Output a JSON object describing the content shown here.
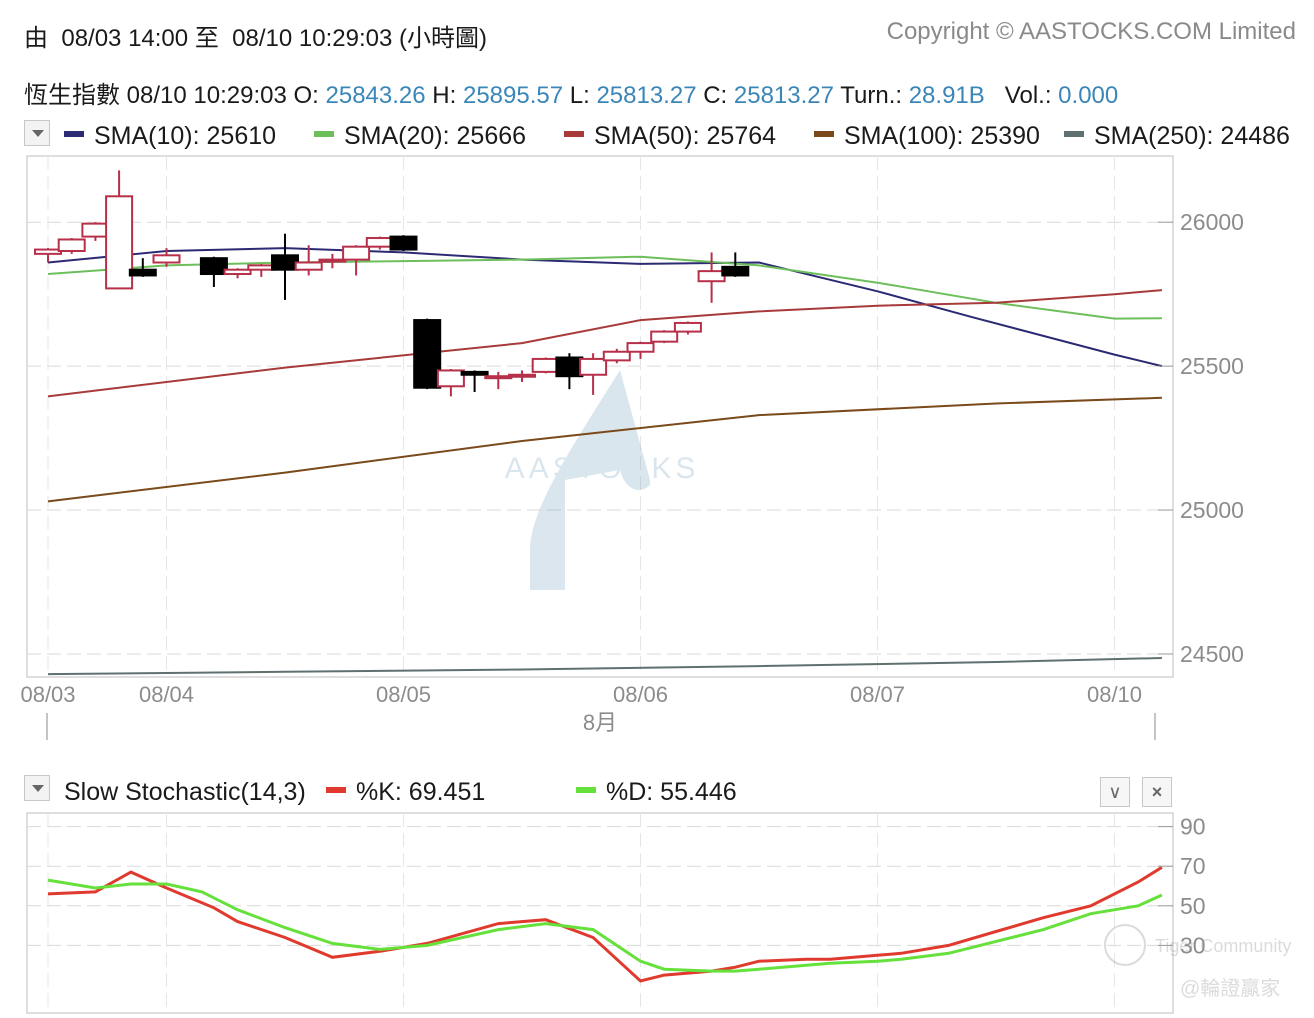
{
  "header": {
    "range_prefix": "由",
    "range_from": "08/03 14:00",
    "range_to_word": "至",
    "range_to": "08/10 10:29:03",
    "range_mode": "(小時圖)",
    "copyright": "Copyright © AASTOCKS.COM Limited"
  },
  "quote": {
    "name": "恆生指數",
    "time": "08/10 10:29:03",
    "open_label": "O:",
    "open": "25843.26",
    "high_label": "H:",
    "high": "25895.57",
    "low_label": "L:",
    "low": "25813.27",
    "close_label": "C:",
    "close": "25813.27",
    "turn_label": "Turn.:",
    "turn": "28.91B",
    "vol_label": "Vol.:",
    "vol": "0.000"
  },
  "sma_legend": [
    {
      "label": "SMA(10): 25610",
      "color": "#2b2a73"
    },
    {
      "label": "SMA(20): 25666",
      "color": "#6cbf5a"
    },
    {
      "label": "SMA(50): 25764",
      "color": "#a83a3a"
    },
    {
      "label": "SMA(100): 25390",
      "color": "#7a4a1a"
    },
    {
      "label": "SMA(250): 24486",
      "color": "#5f7070"
    }
  ],
  "stoch_legend": {
    "title": "Slow Stochastic(14,3)",
    "k_label": "%K: 69.451",
    "d_label": "%D: 55.446",
    "k_color": "#e03a2e",
    "d_color": "#66e03a"
  },
  "watermark": {
    "text": "AASTOCKS",
    "tiger": "Tiger Community",
    "author": "@輪證贏家"
  },
  "chart_data": [
    {
      "type": "candlestick",
      "y_ticks": [
        "26000",
        "25500",
        "25000",
        "24500"
      ],
      "ylim": [
        24420,
        26230
      ],
      "x_tick_labels": [
        "08/03",
        "08/04",
        "08/05",
        "08/06",
        "08/07",
        "08/10"
      ],
      "x_tick_index": [
        0,
        5,
        15,
        25,
        35,
        45
      ],
      "month_label": "8月",
      "up_color": "#b7304a",
      "down_color": "#000000",
      "candles": [
        {
          "o": 25890,
          "h": 25910,
          "l": 25860,
          "c": 25905
        },
        {
          "o": 25900,
          "h": 25945,
          "l": 25890,
          "c": 25940
        },
        {
          "o": 25950,
          "h": 26000,
          "l": 25935,
          "c": 25995
        },
        {
          "o": 25770,
          "h": 26180,
          "l": 25770,
          "c": 26090
        },
        {
          "o": 25835,
          "h": 25875,
          "l": 25810,
          "c": 25815
        },
        {
          "o": 25860,
          "h": 25910,
          "l": 25845,
          "c": 25885
        },
        {
          "o": 25875,
          "h": 25880,
          "l": 25775,
          "c": 25820
        },
        {
          "o": 25820,
          "h": 25840,
          "l": 25805,
          "c": 25835
        },
        {
          "o": 25835,
          "h": 25855,
          "l": 25810,
          "c": 25850
        },
        {
          "o": 25885,
          "h": 25960,
          "l": 25730,
          "c": 25835
        },
        {
          "o": 25835,
          "h": 25920,
          "l": 25815,
          "c": 25860
        },
        {
          "o": 25865,
          "h": 25890,
          "l": 25840,
          "c": 25870
        },
        {
          "o": 25870,
          "h": 25920,
          "l": 25815,
          "c": 25915
        },
        {
          "o": 25915,
          "h": 25950,
          "l": 25905,
          "c": 25945
        },
        {
          "o": 25950,
          "h": 25955,
          "l": 25900,
          "c": 25905
        },
        {
          "o": 25660,
          "h": 25665,
          "l": 25420,
          "c": 25425
        },
        {
          "o": 25430,
          "h": 25490,
          "l": 25395,
          "c": 25485
        },
        {
          "o": 25480,
          "h": 25485,
          "l": 25410,
          "c": 25470
        },
        {
          "o": 25465,
          "h": 25480,
          "l": 25420,
          "c": 25465
        },
        {
          "o": 25465,
          "h": 25485,
          "l": 25445,
          "c": 25470
        },
        {
          "o": 25480,
          "h": 25530,
          "l": 25475,
          "c": 25525
        },
        {
          "o": 25530,
          "h": 25545,
          "l": 25420,
          "c": 25465
        },
        {
          "o": 25470,
          "h": 25545,
          "l": 25400,
          "c": 25525
        },
        {
          "o": 25520,
          "h": 25560,
          "l": 25510,
          "c": 25550
        },
        {
          "o": 25550,
          "h": 25585,
          "l": 25525,
          "c": 25580
        },
        {
          "o": 25585,
          "h": 25625,
          "l": 25580,
          "c": 25620
        },
        {
          "o": 25620,
          "h": 25655,
          "l": 25610,
          "c": 25650
        },
        {
          "o": 25795,
          "h": 25895,
          "l": 25720,
          "c": 25830
        },
        {
          "o": 25845,
          "h": 25895,
          "l": 25810,
          "c": 25815
        }
      ],
      "candle_x_index": [
        0,
        1,
        2,
        3,
        4,
        5,
        7,
        8,
        9,
        10,
        11,
        12,
        13,
        14,
        15,
        16,
        17,
        18,
        19,
        20,
        21,
        22,
        23,
        24,
        25,
        26,
        27,
        28,
        29
      ],
      "series": [
        {
          "name": "SMA(10)",
          "color": "#2b2a73",
          "x": [
            0,
            5,
            10,
            15,
            20,
            25,
            30,
            35,
            39,
            45,
            47
          ],
          "values": [
            25860,
            25900,
            25910,
            25895,
            25870,
            25855,
            25860,
            25760,
            25670,
            25540,
            25500
          ]
        },
        {
          "name": "SMA(20)",
          "color": "#6cbf5a",
          "x": [
            0,
            5,
            10,
            15,
            20,
            25,
            30,
            35,
            40,
            45,
            47
          ],
          "values": [
            25820,
            25850,
            25860,
            25865,
            25870,
            25880,
            25850,
            25790,
            25720,
            25665,
            25666
          ]
        },
        {
          "name": "SMA(50)",
          "color": "#a83a3a",
          "x": [
            0,
            10,
            20,
            25,
            30,
            35,
            40,
            45,
            47
          ],
          "values": [
            25395,
            25495,
            25580,
            25660,
            25690,
            25710,
            25720,
            25750,
            25764
          ]
        },
        {
          "name": "SMA(100)",
          "color": "#7a4a1a",
          "x": [
            0,
            10,
            20,
            30,
            40,
            47
          ],
          "values": [
            25030,
            25130,
            25240,
            25330,
            25370,
            25390
          ]
        },
        {
          "name": "SMA(250)",
          "color": "#5f7070",
          "x": [
            0,
            10,
            20,
            30,
            40,
            47
          ],
          "values": [
            24430,
            24438,
            24446,
            24458,
            24472,
            24486
          ]
        }
      ]
    },
    {
      "type": "line",
      "title": "Slow Stochastic(14,3)",
      "y_ticks": [
        "90",
        "70",
        "50",
        "30"
      ],
      "ylim": [
        0,
        100
      ],
      "series": [
        {
          "name": "%K",
          "color": "#e03a2e",
          "x": [
            0,
            2,
            3.5,
            5,
            7,
            8,
            10,
            12,
            14,
            16,
            19,
            21,
            23,
            25,
            26,
            28,
            29,
            30,
            32,
            33,
            35,
            36,
            38,
            40,
            42,
            44,
            46,
            47
          ],
          "values": [
            56,
            57,
            67,
            59,
            49,
            42,
            34,
            24,
            27,
            31,
            41,
            43,
            34,
            12,
            15,
            17,
            19,
            22,
            23,
            23,
            25,
            26,
            30,
            37,
            44,
            50,
            62,
            69.451
          ]
        },
        {
          "name": "%D",
          "color": "#66e03a",
          "x": [
            0,
            2,
            3.5,
            5,
            6.5,
            8,
            10,
            12,
            14,
            16,
            19,
            21,
            23,
            25,
            26,
            28,
            29,
            30,
            32,
            33,
            35,
            36,
            38,
            40,
            42,
            44,
            46,
            47
          ],
          "values": [
            63,
            59,
            61,
            61,
            57,
            48,
            39,
            31,
            28,
            30,
            38,
            41,
            38,
            22,
            18,
            17,
            17,
            18,
            20,
            21,
            22,
            23,
            26,
            32,
            38,
            46,
            50,
            55.446
          ]
        }
      ]
    }
  ]
}
